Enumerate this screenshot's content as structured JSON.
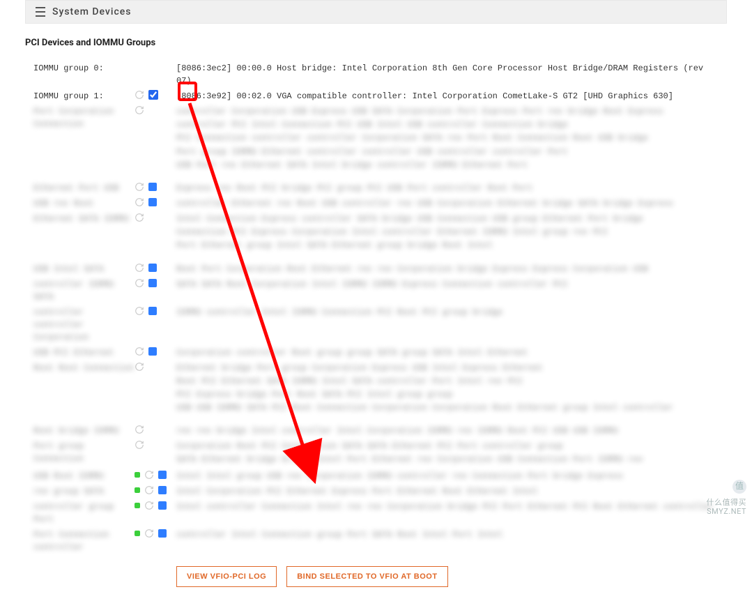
{
  "header": {
    "title": "System Devices"
  },
  "section_title": "PCI Devices and IOMMU Groups",
  "rows": [
    {
      "label": "IOMMU group 0:",
      "desc": "[8086:3ec2] 00:00.0 Host bridge: Intel Corporation 8th Gen Core Processor Host Bridge/DRAM Registers (rev 07)",
      "reload": false,
      "checkbox": false,
      "checked": false
    },
    {
      "label": "IOMMU group 1:",
      "desc": "[8086:3e92] 00:02.0 VGA compatible controller: Intel Corporation CometLake-S GT2 [UHD Graphics 630]",
      "reload": true,
      "checkbox": true,
      "checked": true
    }
  ],
  "blurred_groups": [
    {
      "lines": 5,
      "dots": false,
      "checkbox": false
    },
    {
      "lines": 1,
      "dots": false,
      "checkbox": true
    },
    {
      "lines": 1,
      "dots": false,
      "checkbox": true
    },
    {
      "lines": 3,
      "dots": false,
      "checkbox": false
    },
    {
      "lines": 1,
      "dots": false,
      "checkbox": true
    },
    {
      "lines": 1,
      "dots": false,
      "checkbox": true
    },
    {
      "lines": 1,
      "dots": false,
      "checkbox": true
    },
    {
      "lines": 1,
      "dots": false,
      "checkbox": true
    },
    {
      "lines": 4,
      "dots": false,
      "checkbox": false
    },
    {
      "lines": 1,
      "dots": false,
      "checkbox": false
    },
    {
      "lines": 2,
      "dots": false,
      "checkbox": false
    },
    {
      "lines": 1,
      "dots": true,
      "checkbox": true
    },
    {
      "lines": 1,
      "dots": true,
      "checkbox": true
    },
    {
      "lines": 1,
      "dots": true,
      "checkbox": true
    },
    {
      "lines": 1,
      "dots": true,
      "checkbox": true
    }
  ],
  "buttons": {
    "view_log": "VIEW VFIO-PCI LOG",
    "bind": "BIND SELECTED TO VFIO AT BOOT"
  },
  "watermark": {
    "line1": "什么值得买",
    "line2": "SMYZ.NET"
  },
  "annotation": {
    "highlight_checkbox": true,
    "arrow_target": "bind-button"
  }
}
